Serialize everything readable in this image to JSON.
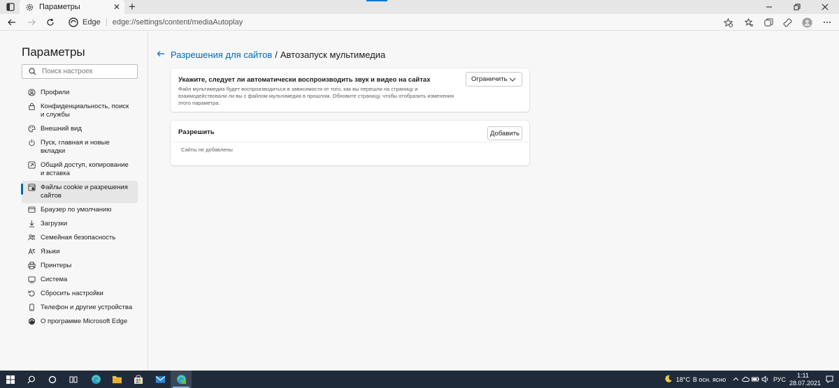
{
  "browser": {
    "tab_title": "Параметры",
    "tab_close": "✕",
    "new_tab": "+",
    "address_site": "Edge",
    "address_url": "edge://settings/content/mediaAutoplay"
  },
  "sidebar": {
    "title": "Параметры",
    "search_placeholder": "Поиск настроек",
    "items": [
      {
        "label": "Профили",
        "icon": "profile-icon"
      },
      {
        "label": "Конфиденциальность, поиск и службы",
        "icon": "lock-icon"
      },
      {
        "label": "Внешний вид",
        "icon": "appearance-icon"
      },
      {
        "label": "Пуск, главная и новые вкладки",
        "icon": "power-icon"
      },
      {
        "label": "Общий доступ, копирование и вставка",
        "icon": "share-icon"
      },
      {
        "label": "Файлы cookie и разрешения сайтов",
        "icon": "cookie-permissions-icon",
        "active": true
      },
      {
        "label": "Браузер по умолчанию",
        "icon": "default-browser-icon"
      },
      {
        "label": "Загрузки",
        "icon": "download-icon"
      },
      {
        "label": "Семейная безопасность",
        "icon": "family-icon"
      },
      {
        "label": "Языки",
        "icon": "language-icon"
      },
      {
        "label": "Принтеры",
        "icon": "printer-icon"
      },
      {
        "label": "Система",
        "icon": "system-icon"
      },
      {
        "label": "Сбросить настройки",
        "icon": "reset-icon"
      },
      {
        "label": "Телефон и другие устройства",
        "icon": "phone-icon"
      },
      {
        "label": "О программе Microsoft Edge",
        "icon": "edge-icon"
      }
    ]
  },
  "main": {
    "breadcrumb_link": "Разрешения для сайтов",
    "breadcrumb_sep": "/",
    "breadcrumb_current": "Автозапуск мультимедиа",
    "autoplay": {
      "title": "Укажите, следует ли автоматически воспроизводить звук и видео на сайтах",
      "description": "Файл мультимедиа будет воспроизводиться в зависимости от того, как вы перешли на страницу и взаимодействовали ли вы с файлом мультимедиа в прошлом. Обновите страницу, чтобы отобразить изменения этого параметра.",
      "selected": "Ограничить"
    },
    "allow": {
      "title": "Разрешить",
      "add_label": "Добавить",
      "empty_text": "Сайты не добавлены"
    }
  },
  "taskbar": {
    "temperature": "18°C",
    "weather": "В осн. ясно",
    "language": "РУС",
    "time": "1:11",
    "date": "28.07.2021"
  },
  "colors": {
    "accent": "#0067c0",
    "taskbar": "#1f2b3a"
  }
}
